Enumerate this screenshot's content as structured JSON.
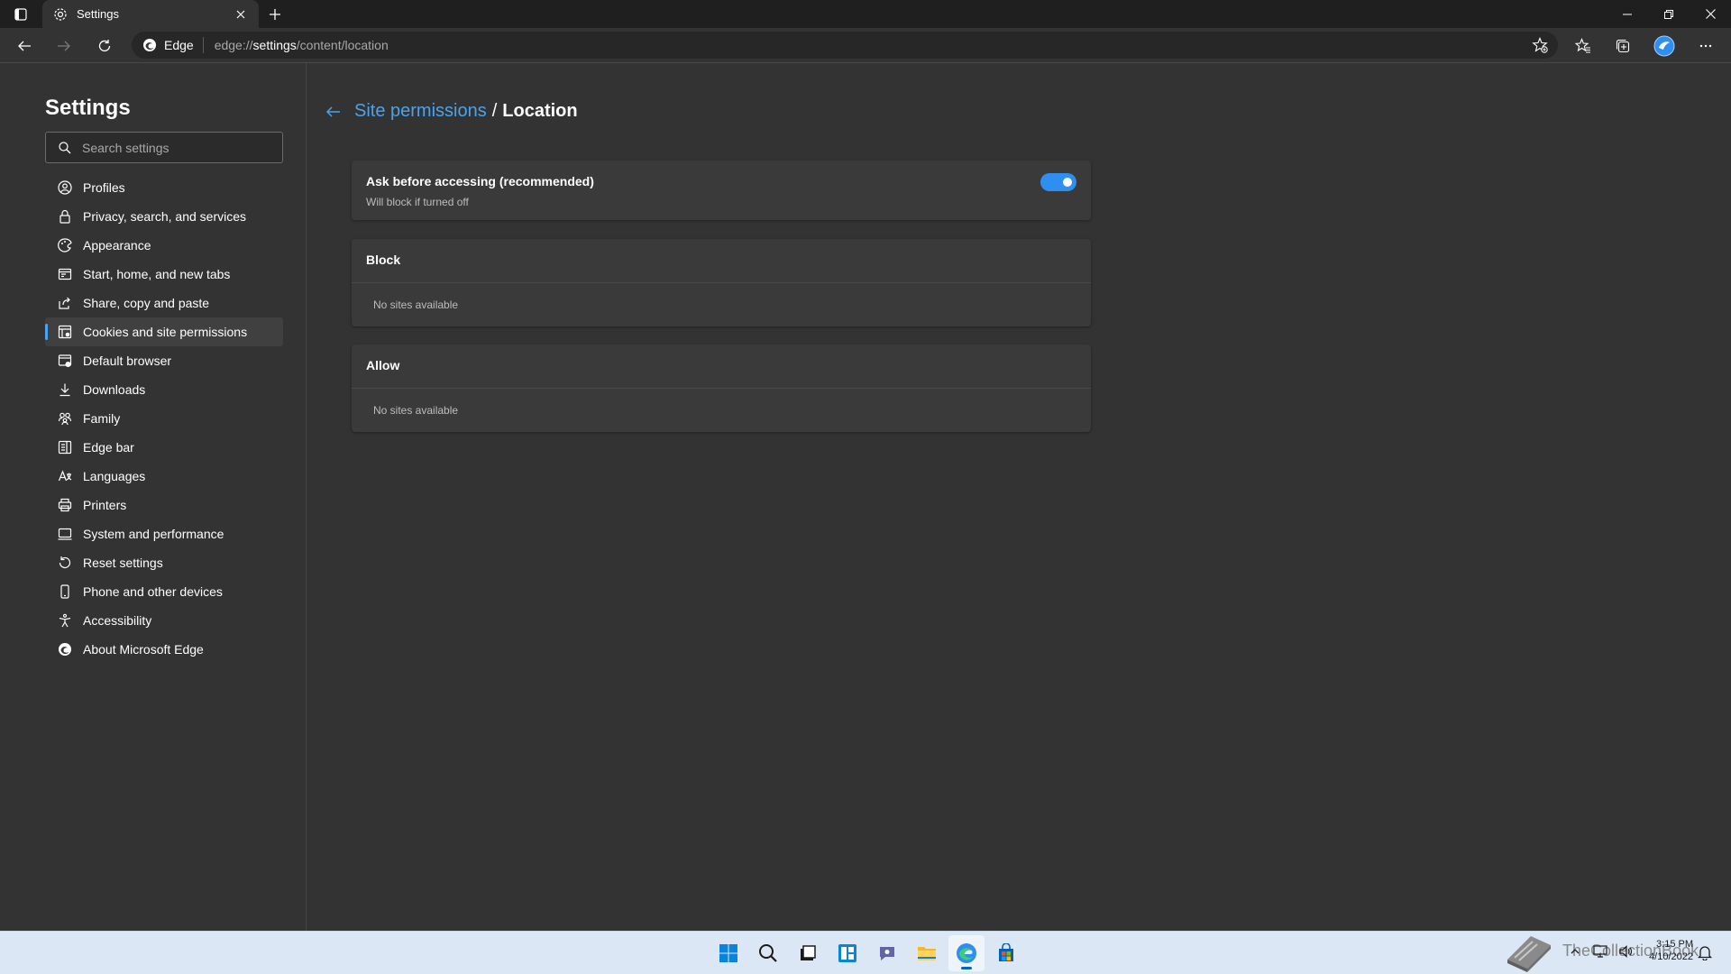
{
  "browser": {
    "tab_title": "Settings",
    "site_name": "Edge",
    "url_prefix": "edge://",
    "url_strong": "settings",
    "url_rest": "/content/location"
  },
  "sidebar": {
    "title": "Settings",
    "search_placeholder": "Search settings",
    "items": [
      {
        "label": "Profiles",
        "icon": "profile-icon"
      },
      {
        "label": "Privacy, search, and services",
        "icon": "lock-icon"
      },
      {
        "label": "Appearance",
        "icon": "appearance-icon"
      },
      {
        "label": "Start, home, and new tabs",
        "icon": "home-tabs-icon"
      },
      {
        "label": "Share, copy and paste",
        "icon": "share-icon"
      },
      {
        "label": "Cookies and site permissions",
        "icon": "cookies-icon",
        "active": true
      },
      {
        "label": "Default browser",
        "icon": "default-browser-icon"
      },
      {
        "label": "Downloads",
        "icon": "download-icon"
      },
      {
        "label": "Family",
        "icon": "family-icon"
      },
      {
        "label": "Edge bar",
        "icon": "edge-bar-icon"
      },
      {
        "label": "Languages",
        "icon": "languages-icon"
      },
      {
        "label": "Printers",
        "icon": "printer-icon"
      },
      {
        "label": "System and performance",
        "icon": "system-icon"
      },
      {
        "label": "Reset settings",
        "icon": "reset-icon"
      },
      {
        "label": "Phone and other devices",
        "icon": "phone-icon"
      },
      {
        "label": "Accessibility",
        "icon": "accessibility-icon"
      },
      {
        "label": "About Microsoft Edge",
        "icon": "edge-logo-icon"
      }
    ]
  },
  "main": {
    "breadcrumb_parent": "Site permissions",
    "breadcrumb_sep": "/",
    "breadcrumb_current": "Location",
    "ask_title": "Ask before accessing (recommended)",
    "ask_subtitle": "Will block if turned off",
    "ask_enabled": true,
    "block_title": "Block",
    "block_empty": "No sites available",
    "allow_title": "Allow",
    "allow_empty": "No sites available"
  },
  "taskbar": {
    "watermark_text": "TheCollectionBook",
    "time": "3:15 PM",
    "date": "4/10/2022"
  },
  "colors": {
    "accent": "#4aa3ec",
    "toggle_on": "#2e8ff0",
    "background": "#333333"
  }
}
